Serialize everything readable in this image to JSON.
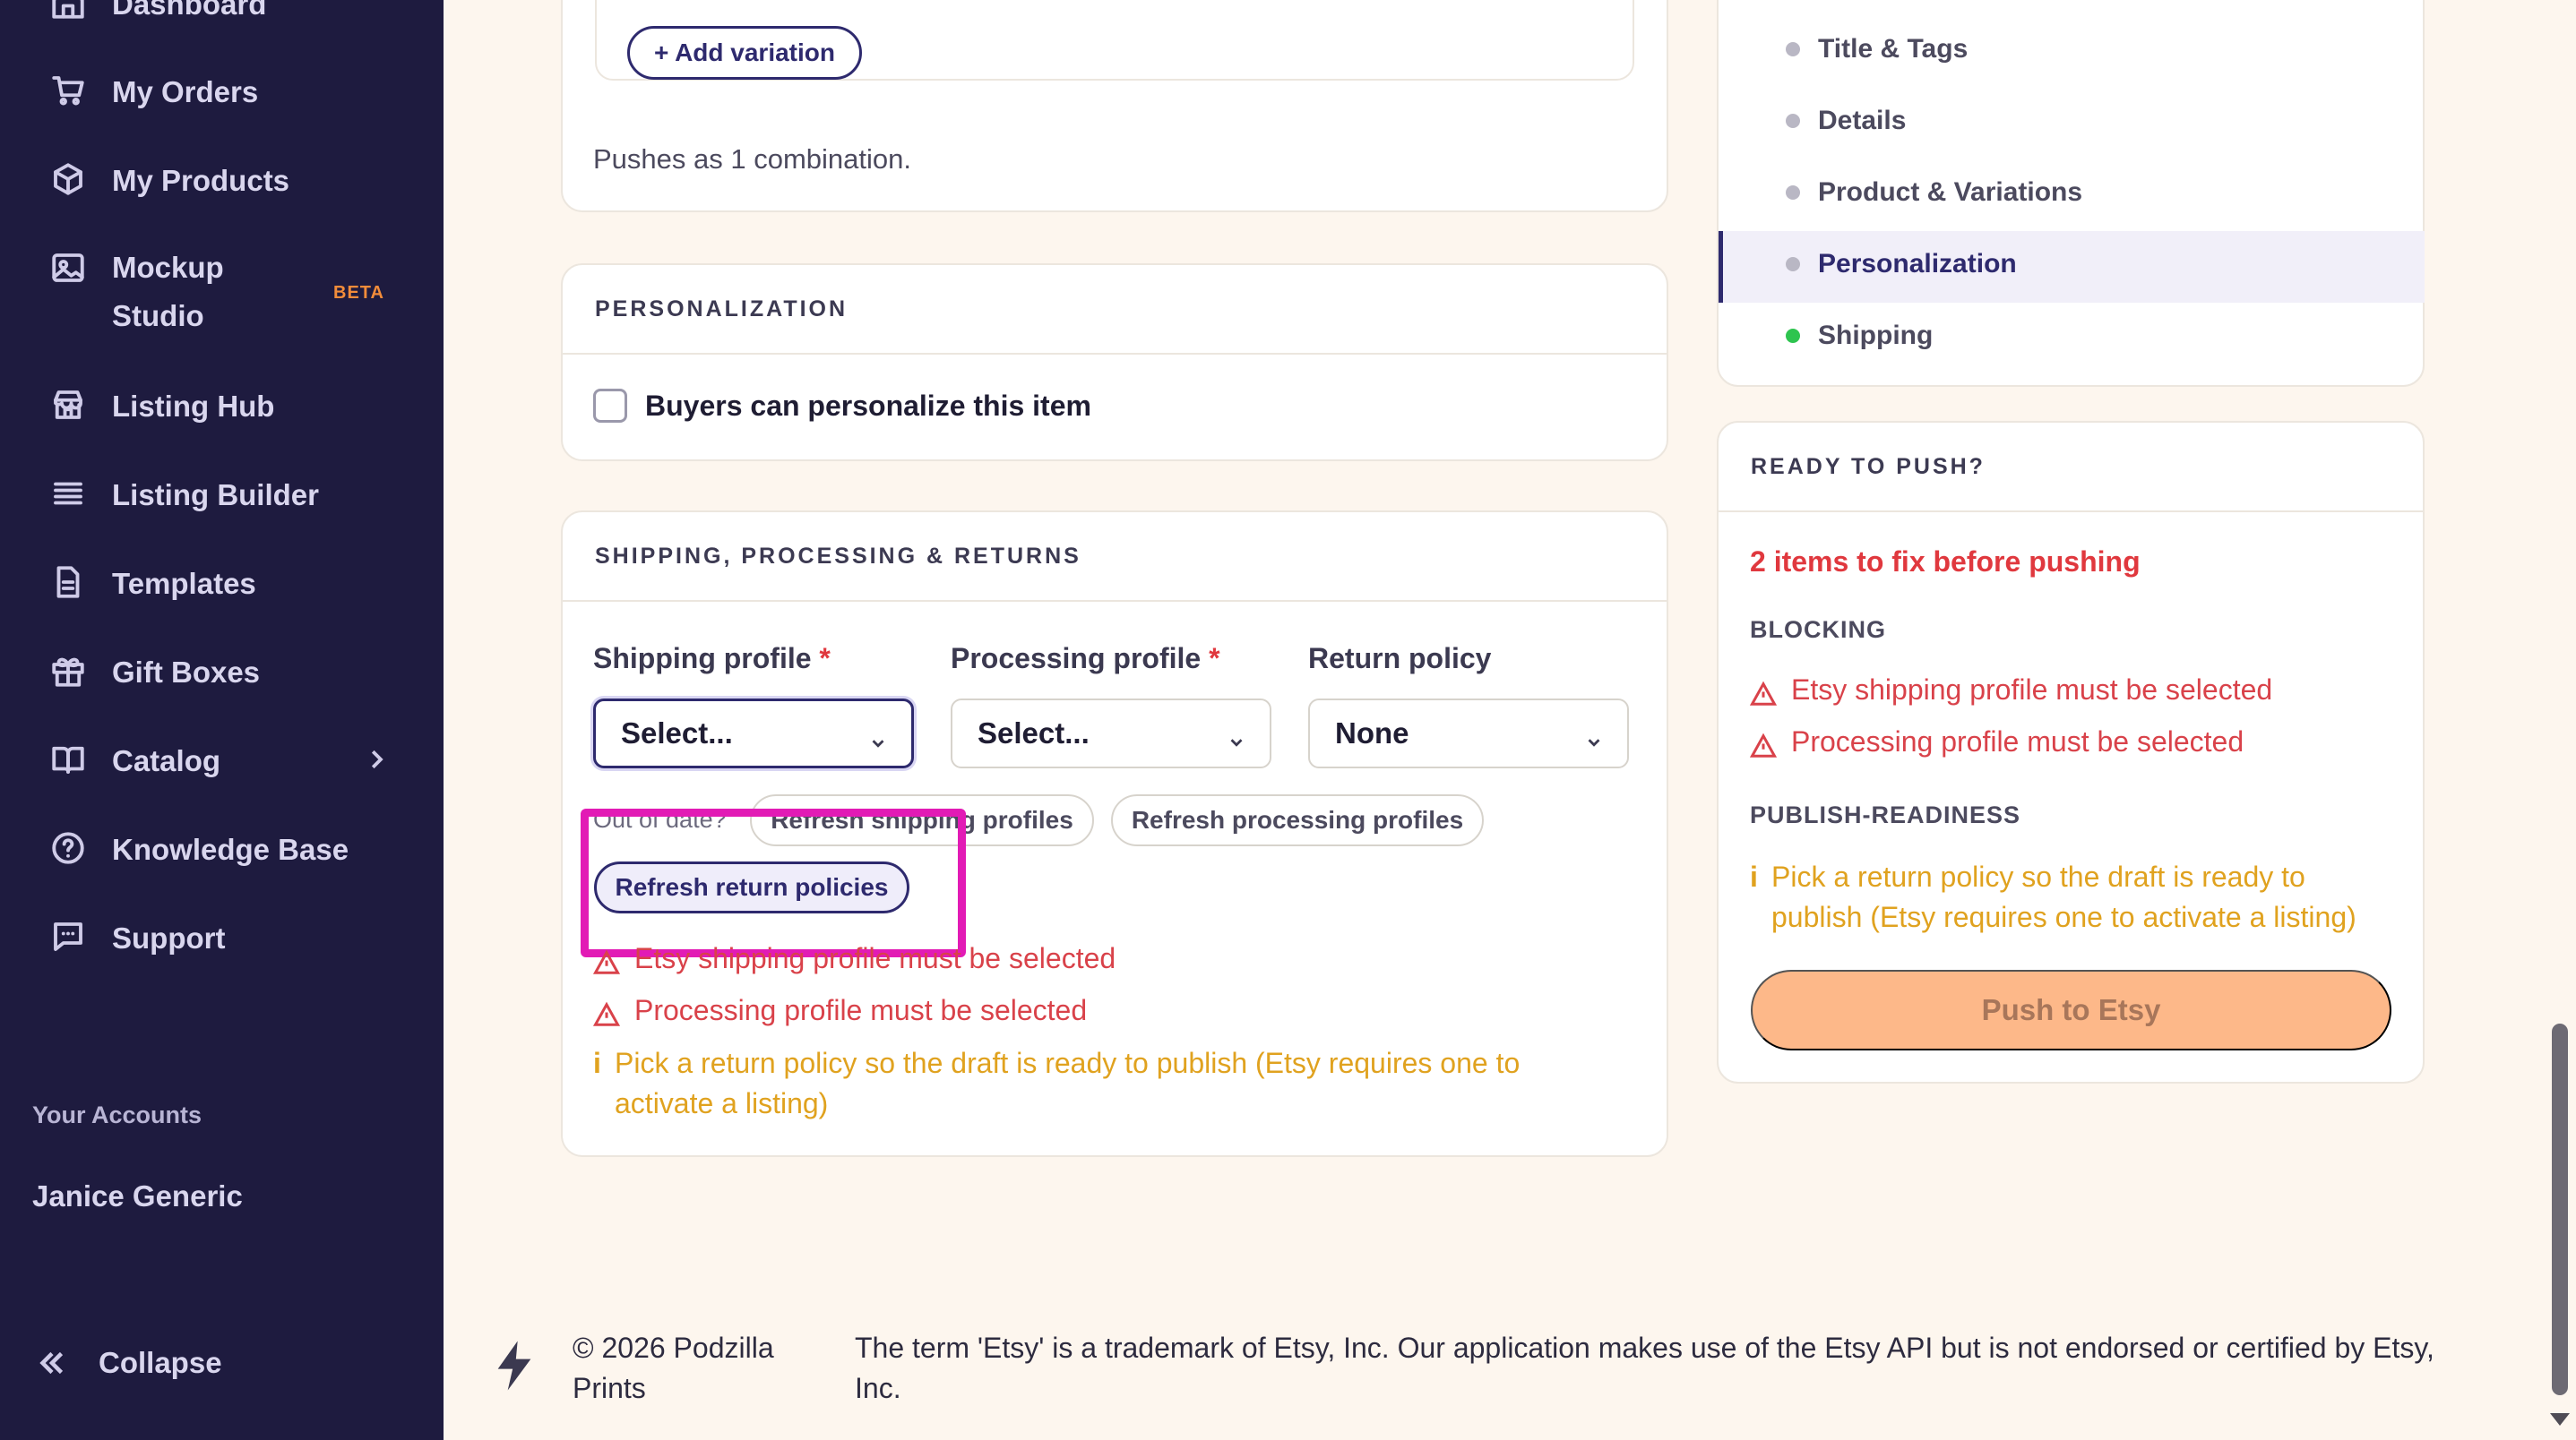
{
  "sidebar": {
    "items": [
      {
        "label": "Dashboard",
        "icon": "home-icon"
      },
      {
        "label": "My Orders",
        "icon": "cart-icon"
      },
      {
        "label": "My Products",
        "icon": "box-icon"
      },
      {
        "label": "Mockup Studio",
        "icon": "image-icon",
        "badge": "BETA"
      },
      {
        "label": "Listing Hub",
        "icon": "store-icon"
      },
      {
        "label": "Listing Builder",
        "icon": "list-icon"
      },
      {
        "label": "Templates",
        "icon": "document-icon"
      },
      {
        "label": "Gift Boxes",
        "icon": "gift-icon"
      },
      {
        "label": "Catalog",
        "icon": "book-icon"
      },
      {
        "label": "Knowledge Base",
        "icon": "help-circle-icon"
      },
      {
        "label": "Support",
        "icon": "chat-icon"
      }
    ],
    "mockup_line1": "Mockup",
    "mockup_line2": "Studio",
    "accounts_label": "Your Accounts",
    "account_name": "Janice Generic",
    "collapse_label": "Collapse"
  },
  "variations": {
    "add_button": "+ Add variation",
    "pushes_text": "Pushes as 1 combination."
  },
  "personalization": {
    "header": "PERSONALIZATION",
    "checkbox_label": "Buyers can personalize this item",
    "checked": false
  },
  "shipping": {
    "header": "SHIPPING, PROCESSING & RETURNS",
    "shipping_profile_label": "Shipping profile",
    "processing_profile_label": "Processing profile",
    "return_policy_label": "Return policy",
    "required_mark": "*",
    "shipping_value": "Select...",
    "processing_value": "Select...",
    "return_value": "None",
    "out_of_date": "Out of date?",
    "refresh_shipping": "Refresh shipping profiles",
    "refresh_processing": "Refresh processing profiles",
    "refresh_return": "Refresh return policies",
    "errors": [
      "Etsy shipping profile must be selected",
      "Processing profile must be selected"
    ],
    "warning_line1": "Pick a return policy so the draft is ready to publish (Etsy requires one to",
    "warning_line2": "activate a listing)"
  },
  "toc": {
    "items": [
      {
        "label": "Title & Tags",
        "status": "gray"
      },
      {
        "label": "Details",
        "status": "gray"
      },
      {
        "label": "Product & Variations",
        "status": "gray"
      },
      {
        "label": "Personalization",
        "status": "gray",
        "active": true
      },
      {
        "label": "Shipping",
        "status": "green"
      }
    ]
  },
  "ready": {
    "header": "READY TO PUSH?",
    "fix_count": "2 items to fix before pushing",
    "blocking_label": "BLOCKING",
    "blocking": [
      "Etsy shipping profile must be selected",
      "Processing profile must be selected"
    ],
    "readiness_label": "PUBLISH-READINESS",
    "readiness_line1": "Pick a return policy so the draft is ready to",
    "readiness_line2": "publish (Etsy requires one to activate a listing)",
    "push_button": "Push to Etsy"
  },
  "footer": {
    "copyright": "© 2026 Podzilla Prints",
    "disclaimer": "The term 'Etsy' is a trademark of Etsy, Inc. Our application makes use of the Etsy API but is not endorsed or certified by Etsy, Inc."
  },
  "info_glyph": "i",
  "colors": {
    "sidebar_bg": "#1e1b3f",
    "accent": "#2e2a6e",
    "error": "#d9424a",
    "warning": "#e0a21f",
    "push_button": "#fdb889",
    "highlight": "#e21bb5"
  }
}
